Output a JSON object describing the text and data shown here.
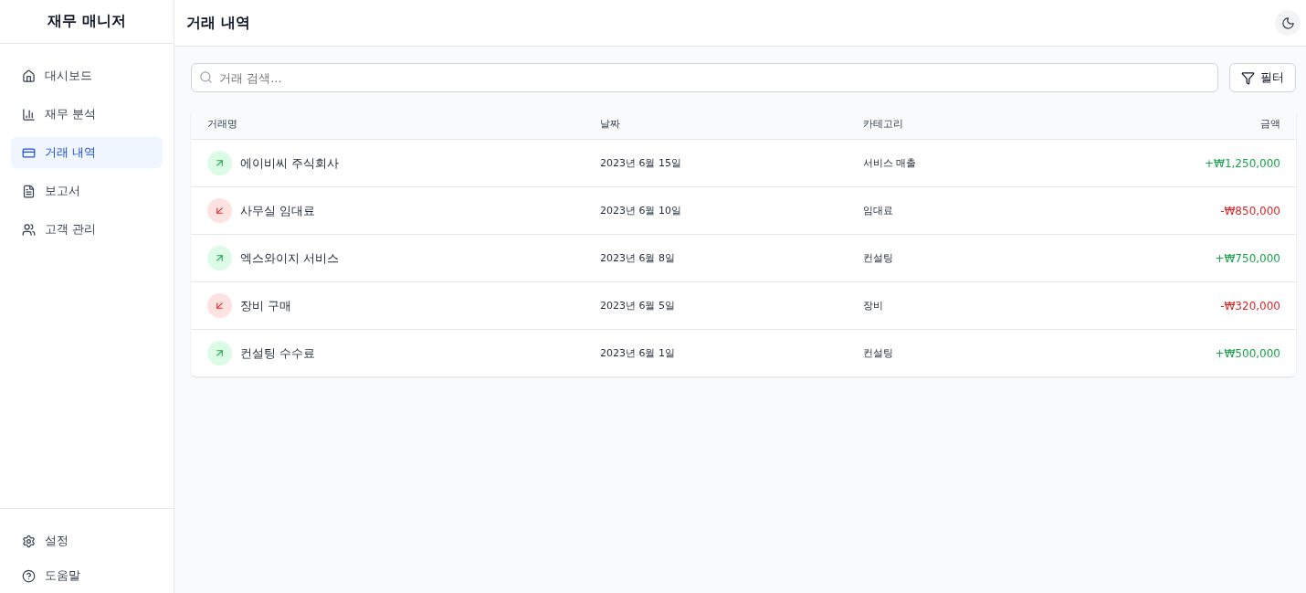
{
  "sidebar": {
    "title": "재무 매니저",
    "items": [
      {
        "label": "대시보드",
        "kind": "home",
        "selected": false
      },
      {
        "label": "재무 분석",
        "kind": "chart",
        "selected": false
      },
      {
        "label": "거래 내역",
        "kind": "card",
        "selected": true
      },
      {
        "label": "보고서",
        "kind": "file",
        "selected": false
      },
      {
        "label": "고객 관리",
        "kind": "users",
        "selected": false
      }
    ],
    "footer_items": [
      {
        "label": "설정",
        "kind": "gear"
      },
      {
        "label": "도움말",
        "kind": "help"
      }
    ]
  },
  "header": {
    "title": "거래 내역"
  },
  "search": {
    "placeholder": "거래 검색..."
  },
  "filter_button": "필터",
  "table": {
    "columns": [
      "거래명",
      "날짜",
      "카테고리",
      "금액"
    ],
    "rows": [
      {
        "kind": "income",
        "name": "에이비씨 주식회사",
        "date": "2023년 6월 15일",
        "category": "서비스 매출",
        "amount": "+₩1,250,000"
      },
      {
        "kind": "expense",
        "name": "사무실 임대료",
        "date": "2023년 6월 10일",
        "category": "임대료",
        "amount": "-₩850,000"
      },
      {
        "kind": "income",
        "name": "엑스와이지 서비스",
        "date": "2023년 6월 8일",
        "category": "컨설팅",
        "amount": "+₩750,000"
      },
      {
        "kind": "expense",
        "name": "장비 구매",
        "date": "2023년 6월 5일",
        "category": "장비",
        "amount": "-₩320,000"
      },
      {
        "kind": "income",
        "name": "컨설팅 수수료",
        "date": "2023년 6월 1일",
        "category": "컨설팅",
        "amount": "+₩500,000"
      }
    ]
  }
}
